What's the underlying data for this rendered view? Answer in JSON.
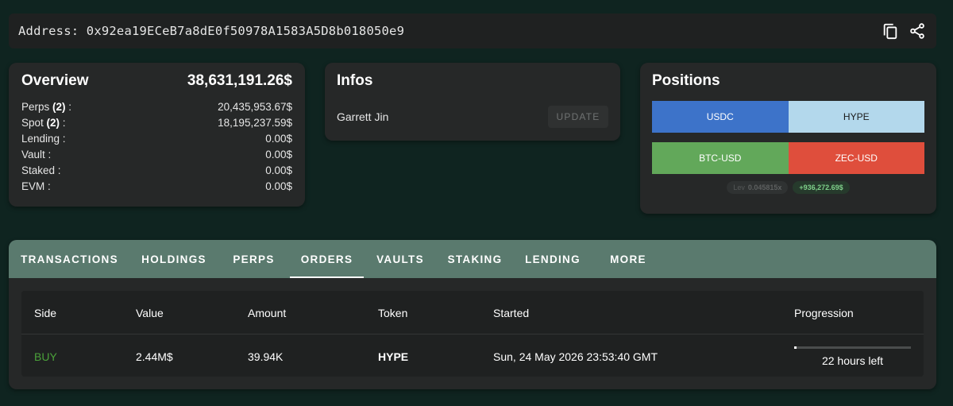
{
  "address": {
    "text": "Address: 0x92ea19ECeB7a8dE0f50978A1583A5D8b018050e9"
  },
  "overview": {
    "title": "Overview",
    "total": "38,631,191.26$",
    "rows": [
      {
        "label": "Perps",
        "count": "(2)",
        "suffix": " :",
        "value": "20,435,953.67$"
      },
      {
        "label": "Spot",
        "count": "(2)",
        "suffix": " :",
        "value": "18,195,237.59$"
      },
      {
        "label": "Lending :",
        "count": "",
        "suffix": "",
        "value": "0.00$"
      },
      {
        "label": "Vault :",
        "count": "",
        "suffix": "",
        "value": "0.00$"
      },
      {
        "label": "Staked :",
        "count": "",
        "suffix": "",
        "value": "0.00$"
      },
      {
        "label": "EVM :",
        "count": "",
        "suffix": "",
        "value": "0.00$"
      }
    ]
  },
  "infos": {
    "title": "Infos",
    "name": "Garrett Jin",
    "update_label": "UPDATE"
  },
  "positions": {
    "title": "Positions",
    "spot": [
      {
        "label": "USDC",
        "color": "#3d73c9",
        "share": 0.5
      },
      {
        "label": "HYPE",
        "color": "#b3d8ec",
        "share": 0.5
      }
    ],
    "perps": [
      {
        "label": "BTC-USD",
        "color": "#62a85a",
        "share": 0.5
      },
      {
        "label": "ZEC-USD",
        "color": "#df4e3c",
        "share": 0.5
      }
    ],
    "leverage_label": "Lev",
    "leverage_value": "0.045815x",
    "pnl": "+936,272.69$"
  },
  "tabs": [
    {
      "label": "TRANSACTIONS",
      "active": false
    },
    {
      "label": "HOLDINGS",
      "active": false
    },
    {
      "label": "PERPS",
      "active": false
    },
    {
      "label": "ORDERS",
      "active": true
    },
    {
      "label": "VAULTS",
      "active": false
    },
    {
      "label": "STAKING",
      "active": false
    },
    {
      "label": "LENDING",
      "active": false
    },
    {
      "label": "MORE",
      "active": false
    }
  ],
  "orders": {
    "columns": [
      "Side",
      "Value",
      "Amount",
      "Token",
      "Started",
      "Progression"
    ],
    "rows": [
      {
        "side": "BUY",
        "value": "2.44M$",
        "amount": "39.94K",
        "token": "HYPE",
        "started": "Sun, 24 May 2026 23:53:40 GMT",
        "progress_fraction": 0.02,
        "progress_text": "22 hours left"
      }
    ]
  },
  "colors": {
    "background": "#0f2420",
    "card": "#262828",
    "tab_bar": "#5a7a6e",
    "buy": "#4ba13a",
    "pnl": "#7fd08a"
  },
  "icons": {
    "copy": "copy-icon",
    "share": "share-icon"
  }
}
